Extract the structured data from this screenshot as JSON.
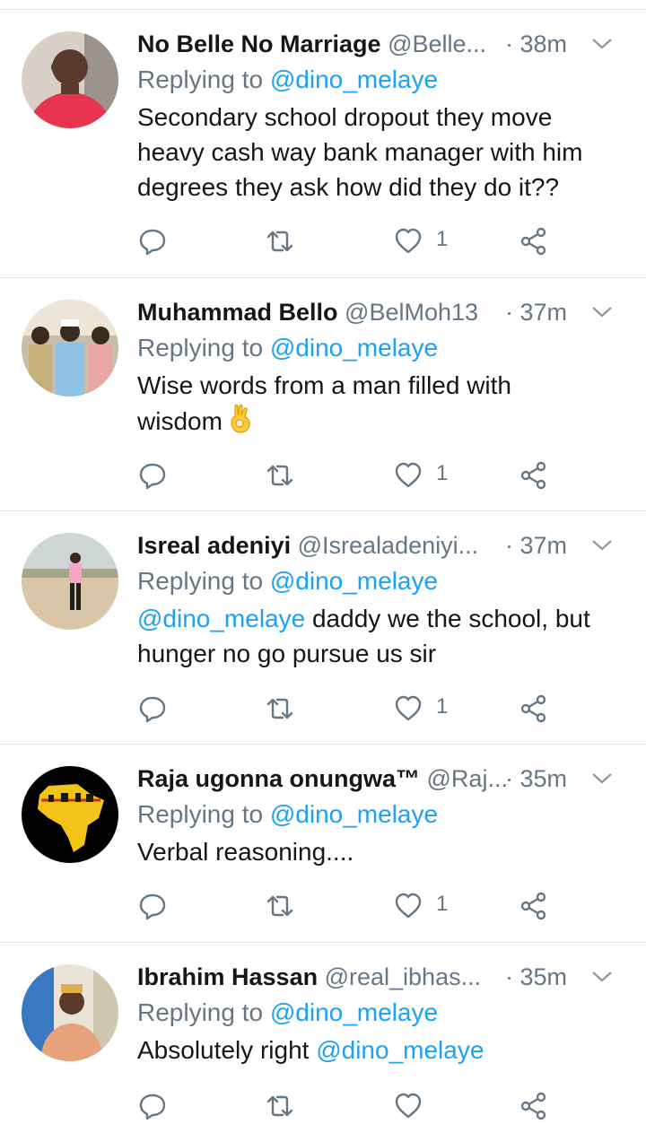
{
  "tweets": [
    {
      "name": "No Belle No Marriage",
      "handle": "@Belle...",
      "time": "· 38m",
      "reply_prefix": "Replying to",
      "reply_to": "@dino_melaye",
      "text": "Secondary school dropout they move heavy cash way bank manager with him degrees they ask how did they do it??",
      "likes": "1"
    },
    {
      "name": "Muhammad Bello",
      "handle": "@BelMoh13",
      "time": "· 37m",
      "reply_prefix": "Replying to",
      "reply_to": "@dino_melaye",
      "text": "Wise words from a man filled with wisdom",
      "emoji": "ok-hand-emoji",
      "likes": "1"
    },
    {
      "name": "Isreal adeniyi",
      "handle": "@Isrealadeniyi...",
      "time": "· 37m",
      "reply_prefix": "Replying to",
      "reply_to": "@dino_melaye",
      "text_mention": "@dino_melaye",
      "text": " daddy we the school, but hunger no go pursue us sir",
      "likes": "1"
    },
    {
      "name": "Raja ugonna onungwa™",
      "handle": "@Raj...",
      "time": "· 35m",
      "reply_prefix": "Replying to",
      "reply_to": "@dino_melaye",
      "text": "Verbal reasoning....",
      "likes": "1"
    },
    {
      "name": "Ibrahim Hassan",
      "handle": "@real_ibhas...",
      "time": "· 35m",
      "reply_prefix": "Replying to",
      "reply_to": "@dino_melaye",
      "text": "Absolutely right ",
      "text_mention_end": "@dino_melaye"
    }
  ],
  "icons": [
    "reply-icon",
    "retweet-icon",
    "like-icon",
    "share-icon",
    "more-options-caret-icon"
  ],
  "colors": {
    "text": "#14171a",
    "secondary": "#657786",
    "mention": "#1da1f2",
    "divider": "#e1e8ed"
  }
}
